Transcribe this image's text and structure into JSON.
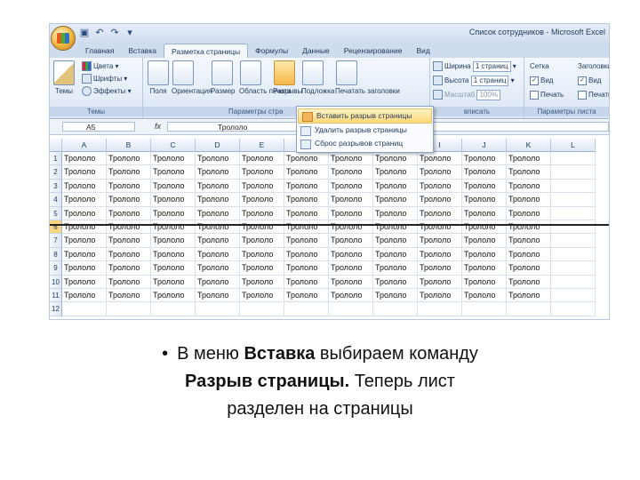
{
  "window": {
    "title": "Список сотрудников - Microsoft Excel"
  },
  "quick_access": {
    "icons": [
      "save-icon",
      "undo-icon",
      "redo-icon",
      "customize-icon"
    ],
    "glyphs": [
      "▣",
      "↶",
      "↷",
      "▾"
    ]
  },
  "ribbon_tabs": [
    {
      "label": "Главная",
      "active": false
    },
    {
      "label": "Вставка",
      "active": false
    },
    {
      "label": "Разметка страницы",
      "active": true
    },
    {
      "label": "Формулы",
      "active": false
    },
    {
      "label": "Данные",
      "active": false
    },
    {
      "label": "Рецензирование",
      "active": false
    },
    {
      "label": "Вид",
      "active": false
    }
  ],
  "ribbon": {
    "themes_group": {
      "label": "Темы",
      "themes_button": "Темы",
      "colors": "Цвета",
      "fonts": "Шрифты",
      "effects": "Эффекты"
    },
    "page_setup_group": {
      "label": "Параметры стра",
      "buttons": [
        "Поля",
        "Ориентация",
        "Размер",
        "Область печати",
        "Разрывы",
        "Подложка",
        "Печатать заголовки"
      ]
    },
    "scale_group": {
      "label": "вписать",
      "width_label": "Ширина",
      "width_value": "1 страниц",
      "height_label": "Высота",
      "height_value": "1 страниц",
      "scale_label": "Масштаб",
      "scale_value": "100%"
    },
    "sheet_options_group": {
      "label": "Параметры листа",
      "gridlines": "Сетка",
      "headings": "Заголовки",
      "view": "Вид",
      "print": "Печать"
    }
  },
  "dropdown_menu": {
    "items": [
      {
        "label": "Вставить разрыв страницы",
        "selected": true
      },
      {
        "label": "Удалить разрыв страницы",
        "selected": false
      },
      {
        "label": "Сброс разрывов страниц",
        "selected": false
      }
    ]
  },
  "formula_bar": {
    "name_box": "A5",
    "fx": "fx",
    "value": "Трололо"
  },
  "sheet": {
    "columns": [
      "A",
      "B",
      "C",
      "D",
      "E",
      "F",
      "G",
      "H",
      "I",
      "J",
      "K",
      "L"
    ],
    "rows": [
      "1",
      "2",
      "3",
      "4",
      "5",
      "6",
      "7",
      "8",
      "9",
      "10",
      "11",
      "12"
    ],
    "cell_text": "Трололо",
    "filled_rows": 11,
    "filled_cols": 11,
    "active_row": "6"
  },
  "caption": {
    "bullet": "•",
    "part1": "В меню ",
    "bold1": "Вставка",
    "part2": " выбираем команду",
    "bold2": "Разрыв страницы.",
    "part3": " Теперь лист",
    "part4": "разделен на страницы"
  }
}
